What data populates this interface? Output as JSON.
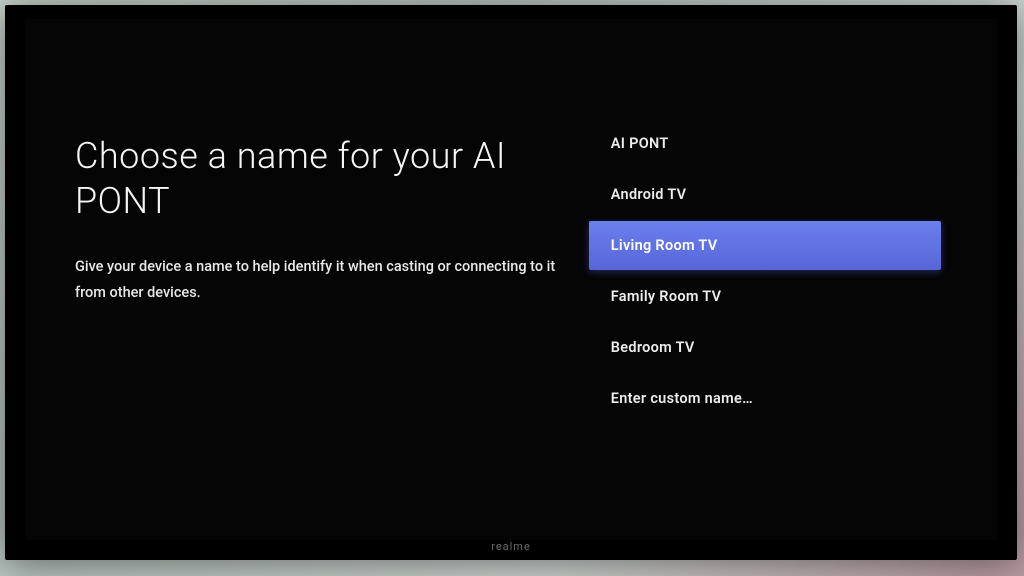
{
  "header": {
    "title": "Choose a name for your AI PONT",
    "subtitle": "Give your device a name to help identify it when casting or connecting to it from other devices."
  },
  "options": [
    {
      "label": "AI PONT",
      "selected": false
    },
    {
      "label": "Android TV",
      "selected": false
    },
    {
      "label": "Living Room TV",
      "selected": true
    },
    {
      "label": "Family Room TV",
      "selected": false
    },
    {
      "label": "Bedroom TV",
      "selected": false
    },
    {
      "label": "Enter custom name…",
      "selected": false
    }
  ],
  "brand": "realme"
}
